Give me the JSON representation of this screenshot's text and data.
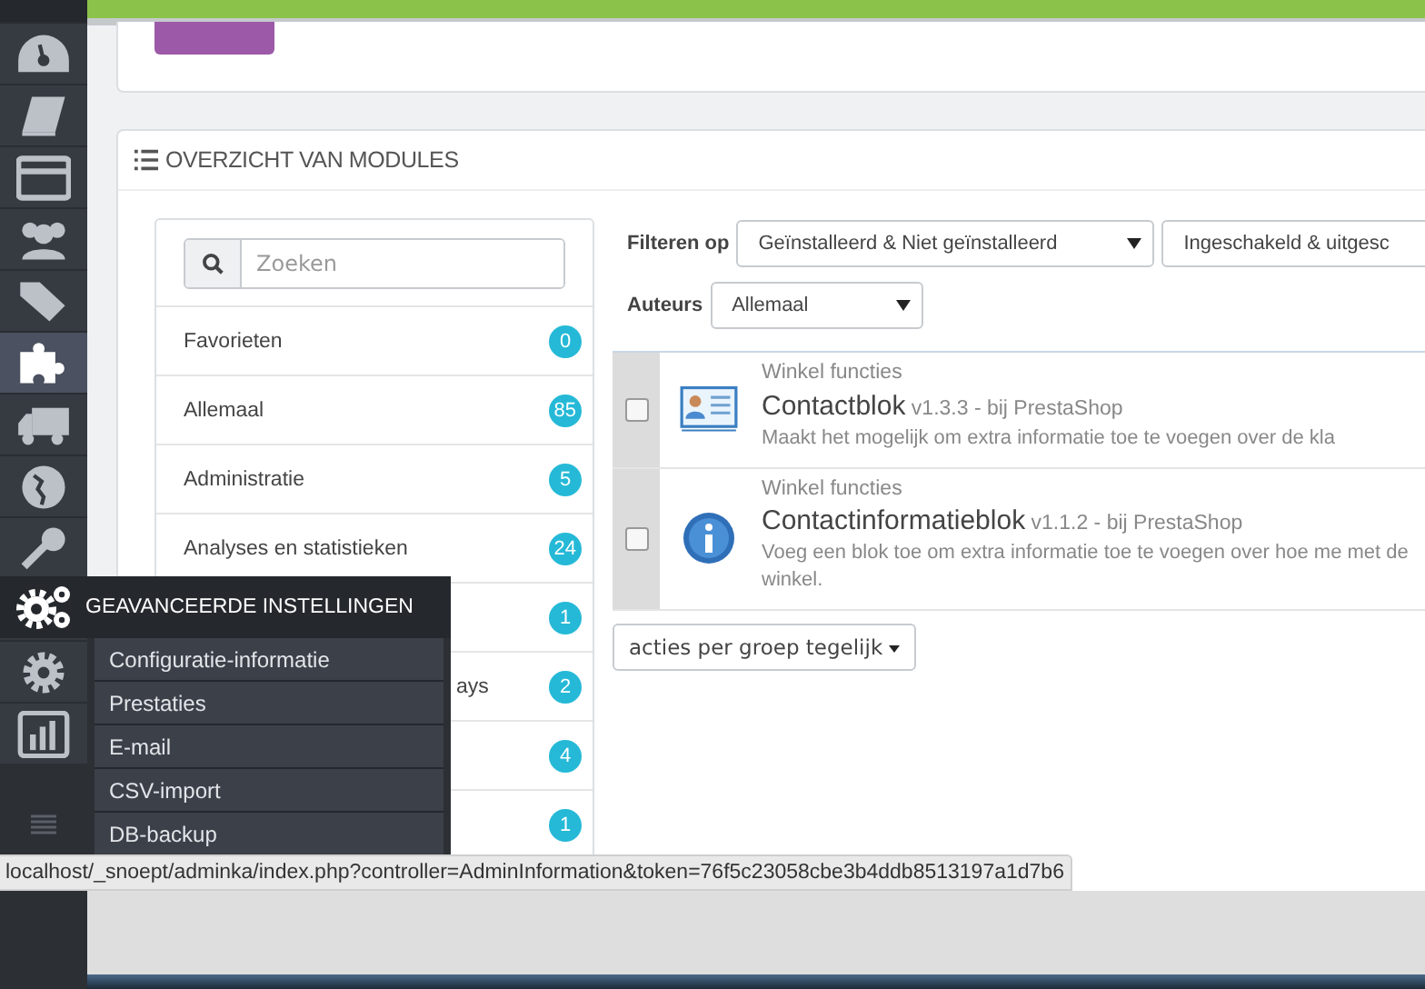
{
  "sidebar": {
    "items": [
      {
        "selected": false
      },
      {
        "selected": false
      },
      {
        "selected": false
      },
      {
        "selected": false
      },
      {
        "selected": false
      },
      {
        "selected": true
      },
      {
        "selected": false
      },
      {
        "selected": false
      },
      {
        "selected": false
      },
      {
        "selected": false
      },
      {
        "selected": false
      }
    ]
  },
  "flyout": {
    "title": "GEAVANCEERDE INSTELLINGEN",
    "items": [
      "Configuratie-informatie",
      "Prestaties",
      "E-mail",
      "CSV-import",
      "DB-backup"
    ]
  },
  "panel": {
    "title": "OVERZICHT VAN MODULES"
  },
  "search": {
    "placeholder": "Zoeken"
  },
  "categories": [
    {
      "kind": "full",
      "label": "Favorieten",
      "count": "0"
    },
    {
      "kind": "full",
      "label": "Allemaal",
      "count": "85"
    },
    {
      "kind": "full",
      "label": "Administratie",
      "count": "5"
    },
    {
      "kind": "full",
      "label": "Analyses en statistieken",
      "count": "24"
    },
    {
      "kind": "hidden",
      "count": "1"
    },
    {
      "kind": "clipped",
      "label": "ays",
      "count": "2"
    },
    {
      "kind": "hidden",
      "count": "4"
    },
    {
      "kind": "hidden",
      "count": "1"
    }
  ],
  "filters": {
    "label": "Filteren op",
    "status": "Geïnstalleerd & Niet geïnstalleerd",
    "state": "Ingeschakeld & uitgesc",
    "authors_label": "Auteurs",
    "authors": "Allemaal"
  },
  "modules": [
    {
      "checked": false,
      "category": "Winkel functies",
      "name": "Contactblok",
      "version": "v1.3.3 - bij PrestaShop",
      "description": "Maakt het mogelijk om extra informatie toe te voegen over de kla"
    },
    {
      "checked": false,
      "category": "Winkel functies",
      "name": "Contactinformatieblok",
      "version": "v1.1.2 - bij PrestaShop",
      "description": "Voeg een blok toe om extra informatie toe te voegen over hoe me met de winkel."
    }
  ],
  "bulk_button": "acties per groep tegelijk",
  "status_url": "localhost/_snoept/adminka/index.php?controller=AdminInformation&token=76f5c23058cbe3b4ddb8513197a1d7b6"
}
